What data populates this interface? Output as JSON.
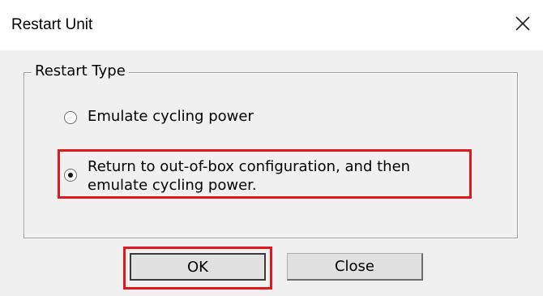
{
  "window": {
    "title": "Restart Unit"
  },
  "group": {
    "label": "Restart Type"
  },
  "options": [
    {
      "label": "Emulate cycling power",
      "selected": false
    },
    {
      "label": "Return to out-of-box configuration, and then\nemulate cycling power.",
      "selected": true
    }
  ],
  "buttons": {
    "ok_label": "OK",
    "close_label": "Close"
  },
  "colors": {
    "highlight": "#e01a1a",
    "dialog_bg": "#f0f0f0"
  }
}
